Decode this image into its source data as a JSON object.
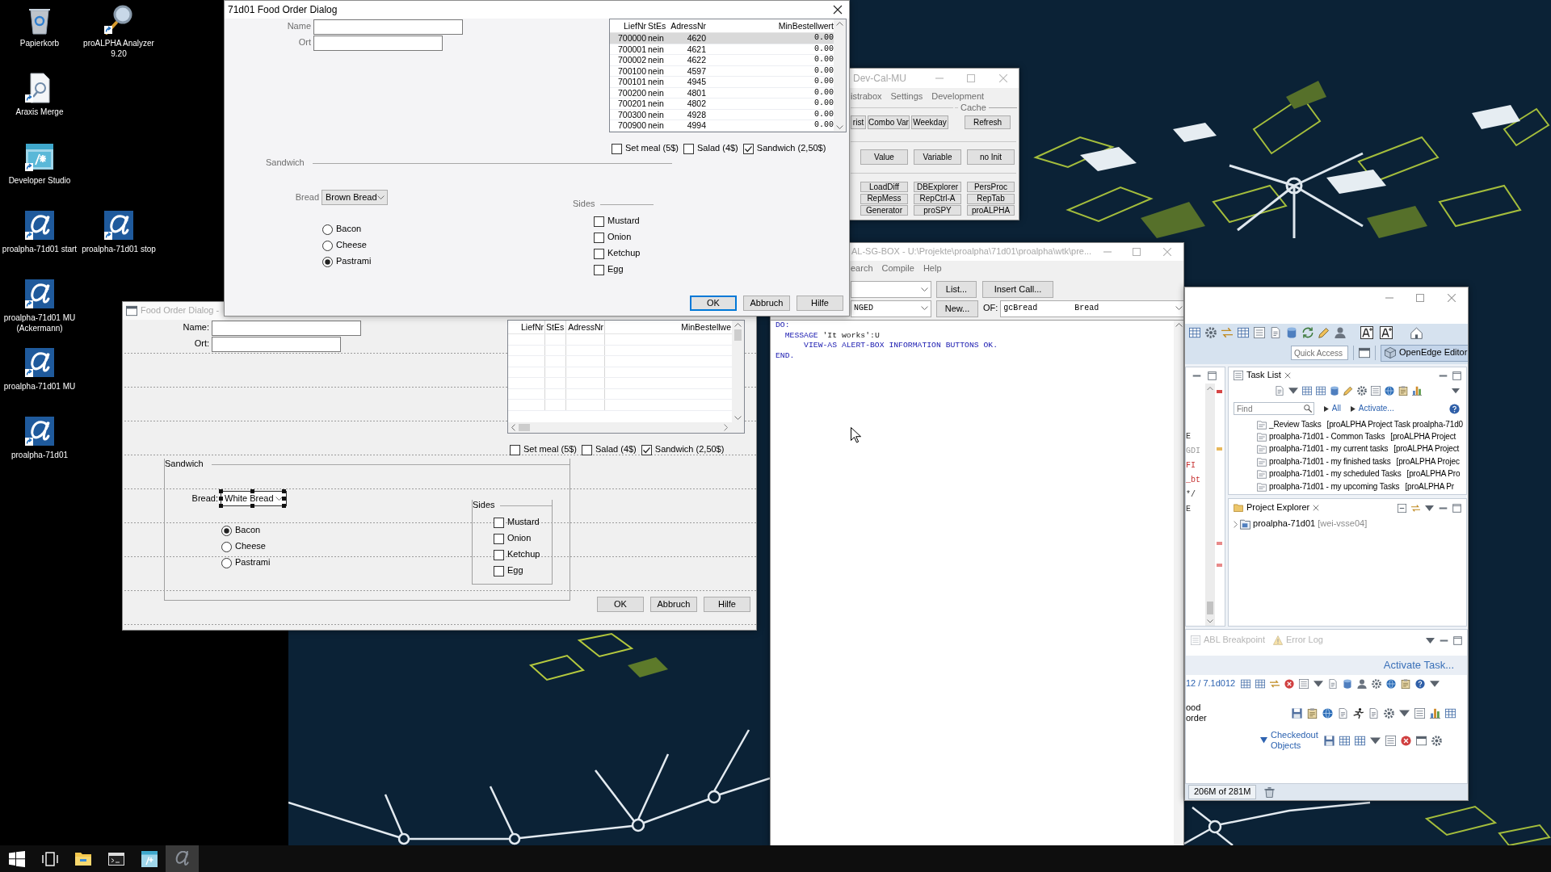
{
  "desktop": {
    "rows": [
      {
        "icons": [
          {
            "kind": "trash",
            "label": "Papierkorb"
          },
          {
            "kind": "magnifier",
            "label": "proALPHA Analyzer 9.20"
          }
        ]
      },
      {
        "icons": [
          {
            "kind": "document",
            "label": "Araxis Merge"
          }
        ]
      },
      {
        "icons": [
          {
            "kind": "studio",
            "label": "Developer Studio"
          }
        ]
      },
      {
        "icons": [
          {
            "kind": "alpha",
            "label": "proalpha-71d01 start"
          },
          {
            "kind": "alpha",
            "label": "proalpha-71d01 stop"
          }
        ]
      },
      {
        "icons": [
          {
            "kind": "alpha",
            "label": "proalpha-71d01 MU (Ackermann)"
          }
        ]
      },
      {
        "icons": [
          {
            "kind": "alpha",
            "label": "proalpha-71d01 MU"
          }
        ]
      },
      {
        "icons": [
          {
            "kind": "alpha",
            "label": "proalpha-71d01"
          }
        ]
      }
    ]
  },
  "dialogs": [
    {
      "kind": "runtime",
      "title": "71d01 Food Order Dialog",
      "fields": [
        {
          "label": "Name"
        },
        {
          "label": "Ort"
        }
      ],
      "browse": {
        "columns": [
          "LiefNr",
          "StEs",
          "AdressNr",
          "MinBestellwert"
        ],
        "rows": [
          {
            "cells": [
              "700000",
              "nein",
              "4620",
              "0.00"
            ],
            "selected": true
          },
          {
            "cells": [
              "700001",
              "nein",
              "4621",
              "0.00"
            ],
            "selected": false
          },
          {
            "cells": [
              "700002",
              "nein",
              "4622",
              "0.00"
            ],
            "selected": false
          },
          {
            "cells": [
              "700100",
              "nein",
              "4597",
              "0.00"
            ],
            "selected": false
          },
          {
            "cells": [
              "700101",
              "nein",
              "4945",
              "0.00"
            ],
            "selected": false
          },
          {
            "cells": [
              "700200",
              "nein",
              "4801",
              "0.00"
            ],
            "selected": false
          },
          {
            "cells": [
              "700201",
              "nein",
              "4802",
              "0.00"
            ],
            "selected": false
          },
          {
            "cells": [
              "700300",
              "nein",
              "4928",
              "0.00"
            ],
            "selected": false
          },
          {
            "cells": [
              "700900",
              "nein",
              "4994",
              "0.00"
            ],
            "selected": false
          }
        ]
      },
      "options": [
        {
          "label": "Set meal (5$)",
          "checked": false
        },
        {
          "label": "Salad (4$)",
          "checked": false
        },
        {
          "label": "Sandwich (2,50$)",
          "checked": true
        }
      ],
      "group": {
        "title": "Sandwich",
        "bread": {
          "label": "Bread",
          "value": "Brown Bread"
        },
        "fillings": [
          {
            "label": "Bacon",
            "selected": false
          },
          {
            "label": "Cheese",
            "selected": false
          },
          {
            "label": "Pastrami",
            "selected": true
          }
        ],
        "sides": {
          "title": "Sides",
          "items": [
            {
              "label": "Mustard",
              "checked": false
            },
            {
              "label": "Onion",
              "checked": false
            },
            {
              "label": "Ketchup",
              "checked": false
            },
            {
              "label": "Egg",
              "checked": false
            }
          ]
        }
      },
      "buttons": [
        {
          "label": "OK",
          "default": true
        },
        {
          "label": "Abbruch",
          "default": false
        },
        {
          "label": "Hilfe",
          "default": false
        }
      ]
    },
    {
      "kind": "design",
      "title": "Food Order Dialog -",
      "fields": [
        {
          "label": "Name:"
        },
        {
          "label": "Ort:"
        }
      ],
      "browse": {
        "columns": [
          "LiefNr",
          "StEs",
          "AdressNr",
          "MinBestellwe"
        ]
      },
      "options": [
        {
          "label": "Set meal (5$)",
          "checked": false
        },
        {
          "label": "Salad (4$)",
          "checked": false
        },
        {
          "label": "Sandwich (2,50$)",
          "checked": true
        }
      ],
      "group": {
        "title": "Sandwich",
        "bread": {
          "label": "Bread:",
          "value": "White Bread",
          "selected": true
        },
        "fillings": [
          {
            "label": "Bacon",
            "selected": true
          },
          {
            "label": "Cheese",
            "selected": false
          },
          {
            "label": "Pastrami",
            "selected": false
          }
        ],
        "sides": {
          "title": "Sides",
          "items": [
            {
              "label": "Mustard",
              "checked": false
            },
            {
              "label": "Onion",
              "checked": false
            },
            {
              "label": "Ketchup",
              "checked": false
            },
            {
              "label": "Egg",
              "checked": false
            }
          ]
        }
      },
      "buttons": [
        {
          "label": "OK"
        },
        {
          "label": "Abbruch"
        },
        {
          "label": "Hilfe"
        }
      ]
    }
  ],
  "tools_window": {
    "title": "Dev-Cal-MU",
    "menu": [
      "istrabox",
      "Settings",
      "Development"
    ],
    "top_buttons": [
      "rist",
      "Combo Var",
      "Weekday"
    ],
    "cache": {
      "title": "Cache",
      "buttons": [
        "Refresh"
      ]
    },
    "button_rows": [
      [
        "Value",
        "Variable",
        "no Init"
      ],
      [
        "LoadDiff",
        "DBExplorer",
        "PersProc"
      ],
      [
        "RepMess",
        "RepCtrl-A",
        "RepTab"
      ],
      [
        "Generator",
        "proSPY",
        "proALPHA"
      ]
    ]
  },
  "editor_window": {
    "title": "AL-SG-BOX - U:\\Projekte\\proalpha\\71d01\\proalpha\\wtk\\pre...",
    "menu": [
      "earch",
      "Compile",
      "Help"
    ],
    "list_button": "List...",
    "insert_button": "Insert Call...",
    "section_value": "NGED",
    "new_button": "New...",
    "of_label": "OF:",
    "of_value": {
      "name": "gcBread",
      "label": "Bread"
    },
    "code": [
      {
        "tokens": [
          {
            "kind": "keyword",
            "text": "DO:"
          }
        ]
      },
      {
        "tokens": [
          {
            "kind": "keyword",
            "text": "  MESSAGE"
          },
          {
            "kind": "string",
            "text": " 'It works':U"
          }
        ]
      },
      {
        "tokens": [
          {
            "kind": "keyword",
            "text": "      VIEW-AS ALERT-BOX INFORMATION BUTTONS OK."
          }
        ]
      },
      {
        "tokens": [
          {
            "kind": "keyword",
            "text": "END."
          }
        ]
      }
    ]
  },
  "ide_window": {
    "quick_access": {
      "placeholder": "Quick Access"
    },
    "perspective": {
      "label": "OpenEdge Editor",
      "selected": true
    },
    "editor_fragments": [
      {
        "text": "E",
        "kind": "plain"
      },
      {
        "text": "GDI",
        "kind": "muted"
      },
      {
        "text": "FI",
        "kind": "error"
      },
      {
        "text": "_bt",
        "kind": "error"
      },
      {
        "text": "*/",
        "kind": "plain"
      },
      {
        "text": "E",
        "kind": "plain"
      }
    ],
    "task_list": {
      "title": "Task List",
      "find_placeholder": "Find",
      "filters": [
        "All",
        "Activate..."
      ],
      "items": [
        {
          "name": "_Review Tasks",
          "detail": "[proALPHA Project Task proalpha-71d0"
        },
        {
          "name": "proalpha-71d01 - Common Tasks",
          "detail": "[proALPHA Project"
        },
        {
          "name": "proalpha-71d01 - my current tasks",
          "detail": "[proALPHA Project"
        },
        {
          "name": "proalpha-71d01 - my finished tasks",
          "detail": "[proALPHA Projec"
        },
        {
          "name": "proalpha-71d01 - my scheduled Tasks",
          "detail": "[proALPHA Pro"
        },
        {
          "name": "proalpha-71d01 - my upcoming Tasks",
          "detail": "[proALPHA Pr"
        }
      ]
    },
    "project_explorer": {
      "title": "Project Explorer",
      "items": [
        {
          "name": "proalpha-71d01",
          "detail": "[wei-vsse04]",
          "expanded": false
        }
      ]
    },
    "bottom_tabs": [
      "ABL Breakpoint",
      "Error Log"
    ],
    "activate_link": "Activate Task...",
    "version": "12 / 7.1d012",
    "food_order": "ood order",
    "checkedout": {
      "label": "Checkedout Objects",
      "expanded": true
    },
    "memory": "206M of 281M"
  },
  "taskbar": {
    "items": [
      {
        "kind": "start",
        "selected": false
      },
      {
        "kind": "taskview",
        "selected": false
      },
      {
        "kind": "folder",
        "selected": false
      },
      {
        "kind": "terminal",
        "selected": false
      },
      {
        "kind": "studio",
        "selected": false
      },
      {
        "kind": "alpha",
        "selected": true
      }
    ]
  }
}
